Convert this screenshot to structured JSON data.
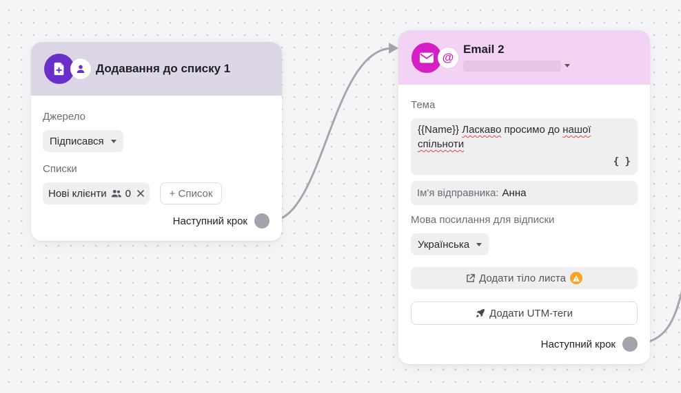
{
  "colors": {
    "card1_header": "#dcd6e6",
    "card1_badge": "#6b2fc9",
    "card2_header": "#f3d3f3",
    "card2_badge": "#d51fc4",
    "connector": "#a6a6ae",
    "warning": "#f5a623"
  },
  "card_list": {
    "icon_main": "add-document-icon",
    "icon_sub": "person-icon",
    "title": "Додавання до списку 1",
    "source_label": "Джерело",
    "source_value": "Підписався",
    "lists_label": "Списки",
    "list_chip_name": "Нові клієнти",
    "list_chip_count": "0",
    "add_list_label": "+ Список",
    "next_step_label": "Наступний крок"
  },
  "card_email": {
    "icon_main": "envelope-icon",
    "icon_sub": "at-sign-icon",
    "title": "Email 2",
    "subject_label": "Тема",
    "subject_prefix": "{{Name}} ",
    "subject_word1": "Ласкаво",
    "subject_mid": " просимо до ",
    "subject_word2": "нашої",
    "subject_word3": "спільноти",
    "variables_button": "{ }",
    "sender_label": "Ім'я відправника:",
    "sender_value": "Анна",
    "unsubscribe_label": "Мова посилання для відписки",
    "unsubscribe_value": "Українська",
    "add_body_label": "Додати тіло листа",
    "add_utm_label": "Додати UTM-теги",
    "next_step_label": "Наступний крок"
  }
}
